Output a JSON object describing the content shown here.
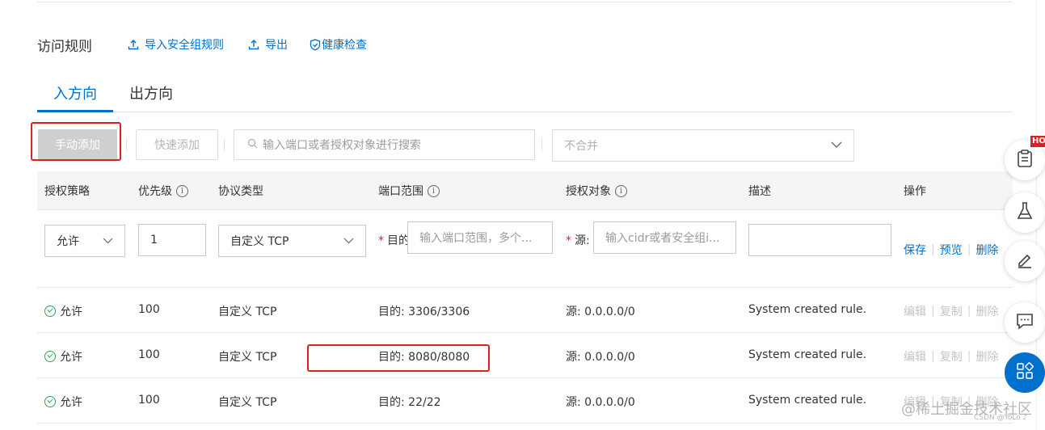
{
  "header": {
    "title": "访问规则",
    "links": [
      {
        "label": "导入安全组规则",
        "icon": "upload-icon"
      },
      {
        "label": "导出",
        "icon": "upload-icon"
      },
      {
        "label": "健康检查",
        "icon": "shield-check-icon"
      }
    ]
  },
  "tabs": [
    {
      "label": "入方向",
      "active": true
    },
    {
      "label": "出方向",
      "active": false
    }
  ],
  "toolbar": {
    "manual_add": "手动添加",
    "quick_add": "快速添加",
    "search_placeholder": "输入端口或者授权对象进行搜索",
    "merge_value": "不合并"
  },
  "table": {
    "columns": [
      "授权策略",
      "优先级",
      "协议类型",
      "端口范围",
      "授权对象",
      "描述",
      "操作"
    ],
    "edit_row": {
      "policy": "允许",
      "priority": "1",
      "protocol": "自定义 TCP",
      "port_label": "目的",
      "port_placeholder": "输入端口范围，多个...",
      "source_label": "源:",
      "source_placeholder": "输入cidr或者安全组i...",
      "description": "",
      "actions": [
        "保存",
        "预览",
        "删除"
      ]
    },
    "rows": [
      {
        "policy": "允许",
        "priority": "100",
        "protocol": "自定义 TCP",
        "port": "目的: 3306/3306",
        "source": "源: 0.0.0.0/0",
        "description": "System created rule.",
        "actions": [
          "编辑",
          "复制",
          "删除"
        ]
      },
      {
        "policy": "允许",
        "priority": "100",
        "protocol": "自定义 TCP",
        "port": "目的: 8080/8080",
        "source": "源: 0.0.0.0/0",
        "description": "System created rule.",
        "actions": [
          "编辑",
          "复制",
          "删除"
        ]
      },
      {
        "policy": "允许",
        "priority": "100",
        "protocol": "自定义 TCP",
        "port": "目的: 22/22",
        "source": "源: 0.0.0.0/0",
        "description": "System created rule.",
        "actions": [
          "编辑",
          "复制",
          "删除"
        ]
      }
    ]
  },
  "floating": {
    "hot_badge": "HOT",
    "buttons": [
      "clipboard-icon",
      "flask-icon",
      "edit-icon",
      "chat-icon",
      "apps-icon"
    ]
  },
  "watermark": {
    "main": "@稀土掘金技术社区",
    "sub": "CSDN @YoLo ♪"
  },
  "colors": {
    "link": "#0070cc",
    "highlight": "#e02020",
    "success": "#2fa34a"
  }
}
